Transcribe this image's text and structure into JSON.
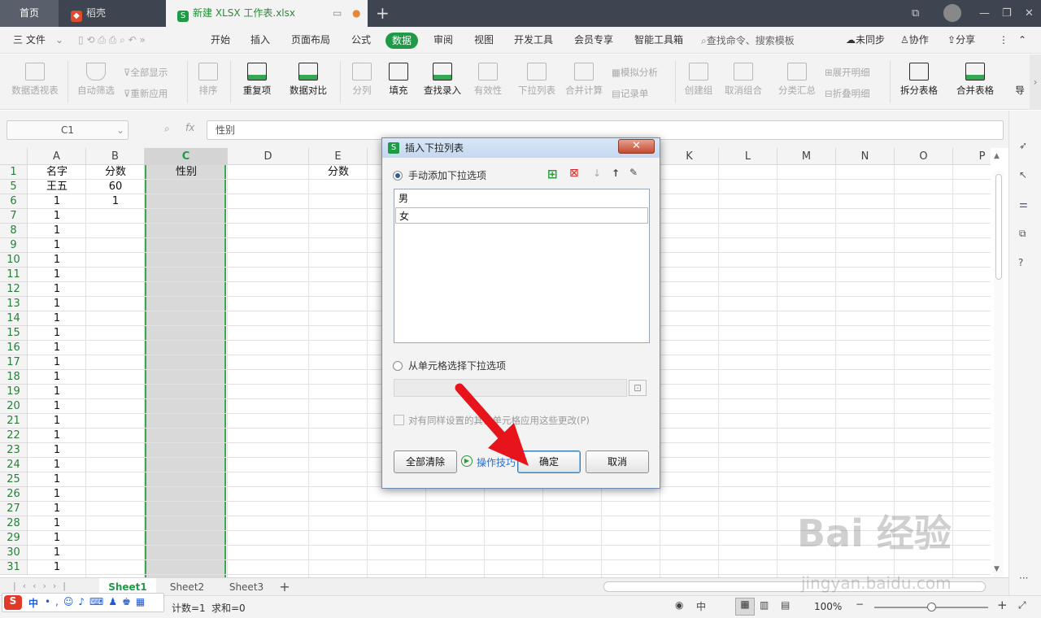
{
  "tabs": {
    "home": "首页",
    "doke": "稻壳",
    "file": "新建 XLSX 工作表.xlsx",
    "add": "+"
  },
  "menu": {
    "file": "三 文件",
    "items": [
      "开始",
      "插入",
      "页面布局",
      "公式",
      "数据",
      "审阅",
      "视图",
      "开发工具",
      "会员专享",
      "智能工具箱"
    ],
    "search": "查找命令、搜索模板",
    "sync": "未同步",
    "collab": "协作",
    "share": "分享"
  },
  "ribbon": {
    "pivot": "数据透视表",
    "autofilter": "自动筛选",
    "showall": "全部显示",
    "reapply": "重新应用",
    "sort": "排序",
    "dup": "重复项",
    "compare": "数据对比",
    "split": "分列",
    "fill": "填充",
    "lookup": "查找录入",
    "valid": "有效性",
    "dropdown": "下拉列表",
    "merge_calc": "合并计算",
    "simulate": "模拟分析",
    "record": "记录单",
    "group": "创建组",
    "ungroup": "取消组合",
    "subtotal": "分类汇总",
    "expand": "展开明细",
    "collapse": "折叠明细",
    "split_table": "拆分表格",
    "merge_table": "合并表格",
    "import": "导"
  },
  "formula_bar": {
    "cell_ref": "C1",
    "fx": "fx",
    "content": "性别"
  },
  "columns": [
    "A",
    "B",
    "C",
    "D",
    "E",
    "F",
    "G",
    "H",
    "I",
    "J",
    "K",
    "L",
    "M",
    "N",
    "O",
    "P"
  ],
  "rows": [
    {
      "n": "1",
      "a": "名字",
      "b": "分数",
      "c": "性别",
      "e": "分数"
    },
    {
      "n": "5",
      "a": "王五",
      "b": "60"
    },
    {
      "n": "6",
      "a": "1",
      "b": "1"
    },
    {
      "n": "7",
      "a": "1"
    },
    {
      "n": "8",
      "a": "1"
    },
    {
      "n": "9",
      "a": "1"
    },
    {
      "n": "10",
      "a": "1"
    },
    {
      "n": "11",
      "a": "1"
    },
    {
      "n": "12",
      "a": "1"
    },
    {
      "n": "13",
      "a": "1"
    },
    {
      "n": "14",
      "a": "1"
    },
    {
      "n": "15",
      "a": "1"
    },
    {
      "n": "16",
      "a": "1"
    },
    {
      "n": "17",
      "a": "1"
    },
    {
      "n": "18",
      "a": "1"
    },
    {
      "n": "19",
      "a": "1"
    },
    {
      "n": "20",
      "a": "1"
    },
    {
      "n": "21",
      "a": "1"
    },
    {
      "n": "22",
      "a": "1"
    },
    {
      "n": "23",
      "a": "1"
    },
    {
      "n": "24",
      "a": "1"
    },
    {
      "n": "25",
      "a": "1"
    },
    {
      "n": "26",
      "a": "1"
    },
    {
      "n": "27",
      "a": "1"
    },
    {
      "n": "28",
      "a": "1"
    },
    {
      "n": "29",
      "a": "1"
    },
    {
      "n": "30",
      "a": "1"
    },
    {
      "n": "31",
      "a": "1"
    }
  ],
  "sheets": [
    "Sheet1",
    "Sheet2",
    "Sheet3"
  ],
  "status": {
    "count": "计数=1",
    "sum": "求和=0",
    "zoom": "100%",
    "ime": "中"
  },
  "dialog": {
    "title": "插入下拉列表",
    "close": "✕",
    "manual_option": "手动添加下拉选项",
    "items": [
      "男",
      "女"
    ],
    "cell_option": "从单元格选择下拉选项",
    "apply_same": "对有同样设置的其他单元格应用这些更改(P)",
    "clear_all": "全部清除",
    "tips": "操作技巧",
    "ok": "确定",
    "cancel": "取消"
  },
  "watermark": {
    "brand": "Bai 经验",
    "url": "jingyan.baidu.com"
  },
  "colors": {
    "accent_green": "#1f9a47",
    "arrow_red": "#e8141c"
  }
}
